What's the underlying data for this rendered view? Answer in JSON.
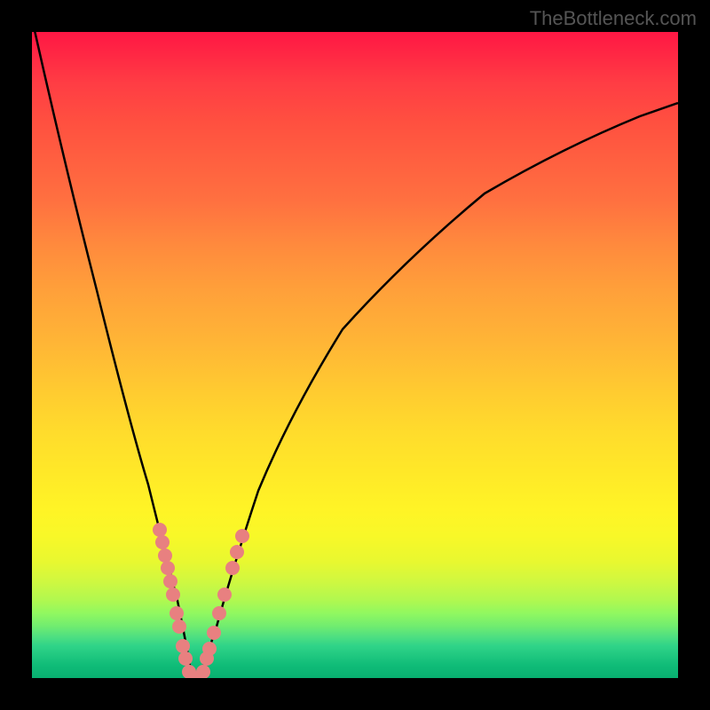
{
  "watermark": {
    "text": "TheBottleneck.com"
  },
  "chart_data": {
    "type": "line",
    "title": "",
    "xlabel": "",
    "ylabel": "",
    "ylim": [
      0,
      100
    ],
    "xlim": [
      0,
      100
    ],
    "curves": {
      "left": {
        "points": [
          [
            0,
            -2
          ],
          [
            5,
            20
          ],
          [
            10,
            40
          ],
          [
            15,
            58
          ],
          [
            18,
            70
          ],
          [
            20.5,
            80
          ],
          [
            22.5,
            88
          ],
          [
            23.8,
            94
          ],
          [
            24.5,
            98
          ],
          [
            25,
            100
          ]
        ]
      },
      "right": {
        "points": [
          [
            26,
            100
          ],
          [
            27,
            97
          ],
          [
            28.5,
            92
          ],
          [
            31,
            83
          ],
          [
            35,
            71
          ],
          [
            40,
            59
          ],
          [
            48,
            46
          ],
          [
            58,
            35
          ],
          [
            70,
            25
          ],
          [
            82,
            18
          ],
          [
            94,
            13
          ],
          [
            100,
            11
          ]
        ]
      }
    },
    "dots": {
      "color": "#e88080",
      "positions": [
        [
          19.8,
          77
        ],
        [
          20.2,
          79
        ],
        [
          20.6,
          81
        ],
        [
          21.0,
          83
        ],
        [
          21.4,
          85
        ],
        [
          21.8,
          87
        ],
        [
          22.4,
          90
        ],
        [
          22.8,
          92
        ],
        [
          23.4,
          95
        ],
        [
          23.8,
          97
        ],
        [
          24.3,
          99
        ],
        [
          25.0,
          100
        ],
        [
          25.8,
          100
        ],
        [
          26.5,
          99
        ],
        [
          27.0,
          97
        ],
        [
          27.5,
          95.5
        ],
        [
          28.2,
          93
        ],
        [
          29.0,
          90
        ],
        [
          29.8,
          87
        ],
        [
          31.0,
          83
        ],
        [
          31.8,
          80.5
        ],
        [
          32.5,
          78
        ]
      ]
    }
  }
}
